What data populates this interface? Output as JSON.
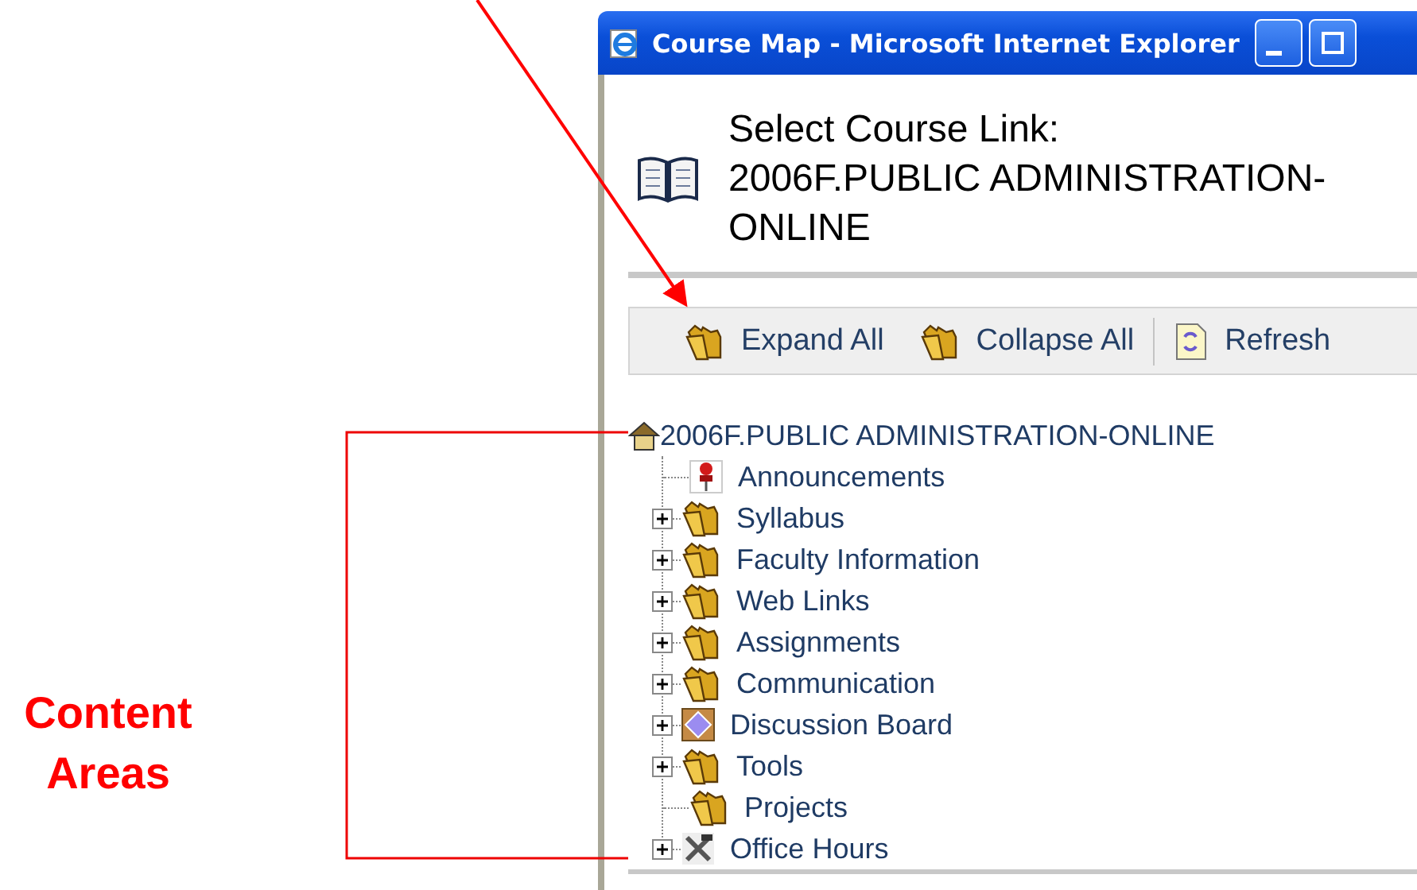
{
  "window": {
    "title": "Course Map - Microsoft Internet Explorer"
  },
  "header": {
    "label": "Select Course Link:",
    "course": "2006F.PUBLIC ADMINISTRATION-ONLINE"
  },
  "toolbar": [
    {
      "label": "Expand All",
      "kind": "expand"
    },
    {
      "label": "Collapse All",
      "kind": "collapse"
    },
    {
      "label": "Refresh",
      "kind": "refresh"
    }
  ],
  "tree": {
    "label": "2006F.PUBLIC ADMINISTRATION-ONLINE",
    "children": [
      {
        "label": "Announcements",
        "kind": "pin",
        "expandable": false
      },
      {
        "label": "Syllabus",
        "kind": "folder",
        "expandable": true
      },
      {
        "label": "Faculty Information",
        "kind": "folder",
        "expandable": true
      },
      {
        "label": "Web Links",
        "kind": "folder",
        "expandable": true
      },
      {
        "label": "Assignments",
        "kind": "folder",
        "expandable": true
      },
      {
        "label": "Communication",
        "kind": "folder",
        "expandable": true
      },
      {
        "label": "Discussion Board",
        "kind": "board",
        "expandable": true
      },
      {
        "label": "Tools",
        "kind": "folder",
        "expandable": true
      },
      {
        "label": "Projects",
        "kind": "folder",
        "expandable": false
      },
      {
        "label": "Office Hours",
        "kind": "tools",
        "expandable": true
      }
    ]
  },
  "annotation": {
    "label": "Content Areas"
  }
}
